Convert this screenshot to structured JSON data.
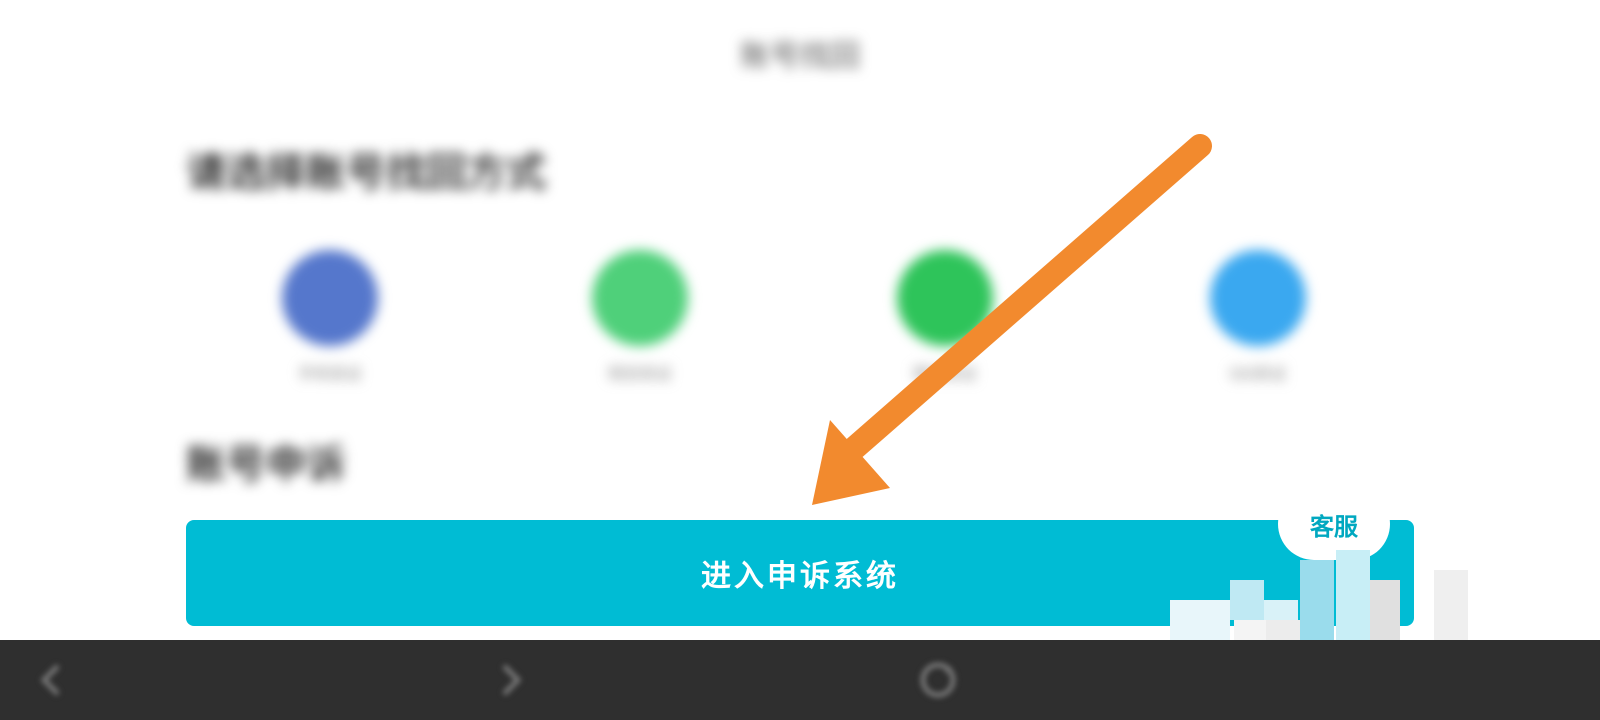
{
  "header": {
    "title": "账号找回"
  },
  "sections": {
    "recovery_heading": "请选择账号找回方式",
    "appeal_heading": "账号申诉"
  },
  "methods": [
    {
      "label": "手机验证",
      "icon": "phone-icon",
      "color": "#5577cc"
    },
    {
      "label": "短信验证",
      "icon": "message-icon",
      "color": "#4fd07a"
    },
    {
      "label": "微信验证",
      "icon": "wechat-icon",
      "color": "#2ec45a"
    },
    {
      "label": "QQ验证",
      "icon": "qq-icon",
      "color": "#3aa8f0"
    }
  ],
  "appeal_button": {
    "label": "进入申诉系统",
    "color": "#00bcd4"
  },
  "service_badge": {
    "label": "客服"
  },
  "annotation": {
    "arrow_color": "#f28a2e"
  },
  "nav": {
    "back_icon": "chevron-left-icon",
    "forward_icon": "chevron-right-icon",
    "refresh_icon": "refresh-icon"
  }
}
